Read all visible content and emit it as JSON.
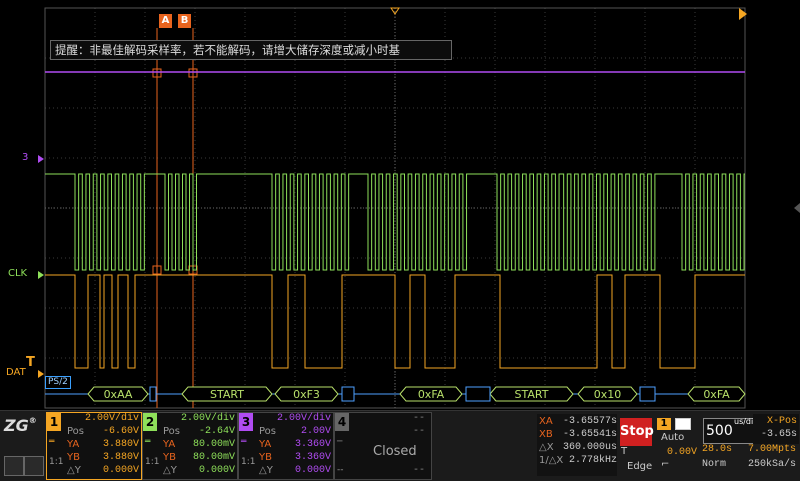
{
  "colors": {
    "ch1": "#f5a623",
    "ch2": "#8ee05a",
    "ch3": "#b04cf2",
    "decode_bus": "#4ea0ff",
    "decode_box": "#b8e06a",
    "cursor": "#e8641e",
    "stop": "#d02020"
  },
  "hint_text": "提醒：非最佳解码采样率，若不能解码，请增大储存深度或减小时基",
  "cursor_tags": {
    "a": "A",
    "b": "B"
  },
  "channel_labels": {
    "ch3": "3",
    "clk": "CLK",
    "dat": "DAT"
  },
  "protocol_label": "PS/2",
  "decode_packets": [
    "0xAA",
    "START",
    "0xF3",
    "0xFA",
    "START",
    "0x10",
    "0xFA"
  ],
  "panel": {
    "ch1": {
      "num": "1",
      "scale": "2.00V/div",
      "pos_label": "Pos",
      "pos": "-6.60V",
      "ya_label": "YA",
      "ya": "3.880V",
      "yb_label": "YB",
      "yb": "3.880V",
      "dy_label": "△Y",
      "dy": "0.000V",
      "mode": "1:1"
    },
    "ch2": {
      "num": "2",
      "scale": "2.00V/div",
      "pos_label": "Pos",
      "pos": "-2.64V",
      "ya_label": "YA",
      "ya": "80.00mV",
      "yb_label": "YB",
      "yb": "80.00mV",
      "dy_label": "△Y",
      "dy": "0.000V",
      "mode": "1:1"
    },
    "ch3": {
      "num": "3",
      "scale": "2.00V/div",
      "pos_label": "Pos",
      "pos": "2.00V",
      "ya_label": "YA",
      "ya": "3.360V",
      "yb_label": "YB",
      "yb": "3.360V",
      "dy_label": "△Y",
      "dy": "0.000V",
      "mode": "1:1"
    },
    "ch4": {
      "num": "4",
      "dash1": "--",
      "dash2": "--",
      "dash3": "--",
      "dash4": "--",
      "status": "Closed"
    },
    "cursor_meas": {
      "xa_label": "XA",
      "xa": "-3.65577s",
      "xb_label": "XB",
      "xb": "-3.65541s",
      "dx_label": "△X",
      "dx": "360.000us",
      "f_label": "1/△X",
      "f": "2.778kHz"
    },
    "run_state": "Stop",
    "trigger": {
      "src": "1",
      "mode": "Auto",
      "type_label": "T",
      "level": "0.00V",
      "edge": "Edge"
    },
    "timebase": {
      "value": "500",
      "unit": "us/div",
      "xpos_label": "X-Pos",
      "xpos": "-3.65s",
      "time": "28.0s",
      "depth": "7.00Mpts",
      "acq": "Norm",
      "rate": "250kSa/s"
    }
  }
}
